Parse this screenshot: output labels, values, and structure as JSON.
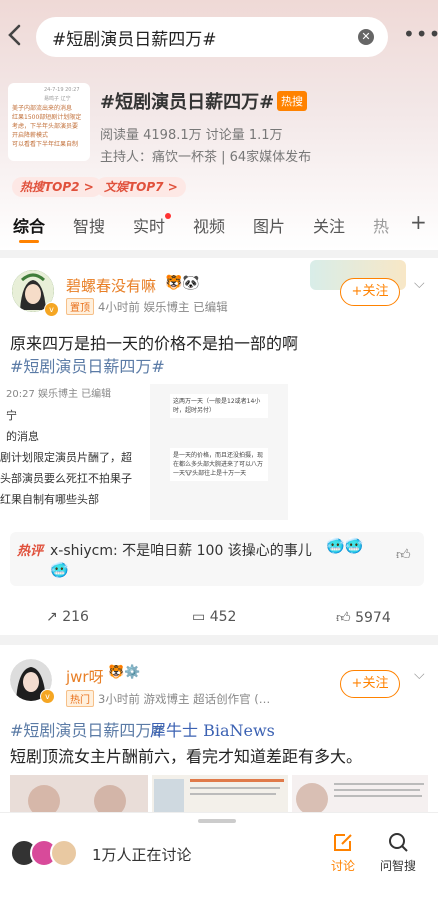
{
  "search": {
    "query": "#短剧演员日薪四万#",
    "clear_icon": "close-icon",
    "back_icon": "chevron-left-icon",
    "more_icon": "more-icon"
  },
  "topic": {
    "title": "#短剧演员日薪四万#",
    "hot_badge": "热搜",
    "stats": "阅读量 4198.1万  讨论量 1.1万",
    "host": "主持人：痛饮一杯茶 | 64家媒体发布",
    "thumbnail_lines": [
      "美子内部流出来的消息",
      "红果1500部短剧计划限定",
      "考虑，下半年头部演员要",
      "开启降薪模式",
      "可以看看下半年红果自制"
    ],
    "thumbnail_ts": "24-7-19 20:27\n易鸣子 辽宁",
    "rank1": "热搜TOP2 >",
    "rank2": "文娱TOP7 >"
  },
  "tabs": [
    "综合",
    "智搜",
    "实时",
    "视频",
    "图片",
    "关注",
    "热"
  ],
  "tabs_more_icon": "plus-icon",
  "post1": {
    "username": "碧螺春没有嘛",
    "pin_tag": "置顶",
    "meta": "4小时前  娱乐博主  已编辑",
    "follow": "+关注",
    "text": "原来四万是拍一天的价格不是拍一部的啊",
    "hashtag": "#短剧演员日薪四万#",
    "img_left_lines": [
      "20:27  娱乐博主  已编辑",
      "宁",
      "的消息",
      "剧计划限定演员片酬了，超",
      "头部演员要么死扛不拍果子",
      "红果自制有哪些头部"
    ],
    "img_right_lines": [
      "这两万一天（一般是12或者14小时，超时另付）",
      "是一天的价格，而且还没拍摄，现在都么多头部大腕进来了可以八万一天🐮头部往上是十万一天"
    ],
    "hot_comment_label": "热评",
    "hot_comment": "x-shiycm: 不是咱日薪 100 该操心的事儿",
    "repost": "216",
    "comments": "452",
    "likes": "5974"
  },
  "post2": {
    "username": "jwr呀",
    "hot_tag": "热门",
    "meta": "3小时前  游戏博主  超话创作官 (…",
    "follow": "+关注",
    "hashtag": "#短剧演员日薪四万#",
    "watermark": "犀牛士 BiaNews",
    "text": "短剧顶流女主片酬前六，看完才知道差距有多大。"
  },
  "bottom": {
    "discussing": "1万人正在讨论",
    "discuss_label": "讨论",
    "ask_label": "问智搜"
  }
}
